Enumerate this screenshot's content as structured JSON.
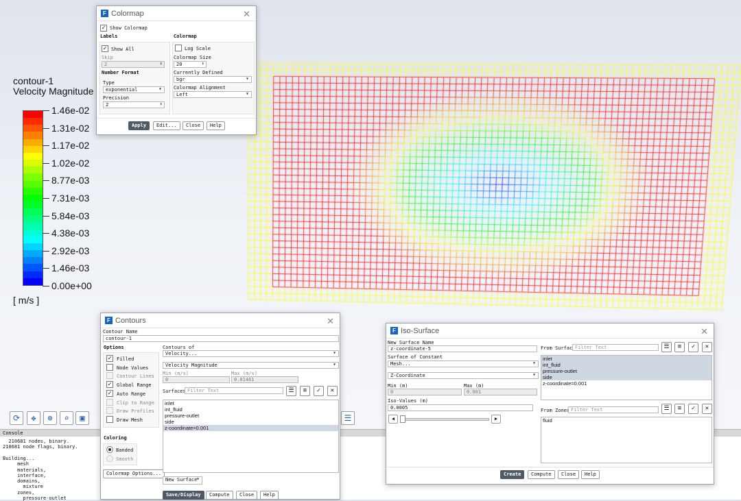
{
  "legend": {
    "title_line1": "contour-1",
    "title_line2": "Velocity Magnitude",
    "labels": [
      "1.46e-02",
      "1.31e-02",
      "1.17e-02",
      "1.02e-02",
      "8.77e-03",
      "7.31e-03",
      "5.84e-03",
      "4.38e-03",
      "2.92e-03",
      "1.46e-03",
      "0.00e+00"
    ],
    "unit": "[ m/s ]",
    "colors": [
      "#ff0000",
      "#ff2a00",
      "#ff5500",
      "#ff8000",
      "#ffaa00",
      "#ffd500",
      "#ffff00",
      "#d5ff00",
      "#aaff00",
      "#80ff00",
      "#55ff00",
      "#2aff00",
      "#00ff00",
      "#00ff2a",
      "#00ff55",
      "#00ff80",
      "#00ffaa",
      "#00ffd5",
      "#00ffff",
      "#00d5ff",
      "#00aaff",
      "#0080ff",
      "#0055ff",
      "#002aff",
      "#0000ff"
    ]
  },
  "colormap": {
    "title": "Colormap",
    "show_colormap": "Show Colormap",
    "labels_head": "Labels",
    "show_all": "Show All",
    "skip_label": "Skip",
    "skip_value": "2",
    "number_format": "Number Format",
    "type_label": "Type",
    "type_value": "exponential",
    "precision_label": "Precision",
    "precision_value": "2",
    "colormap_head": "Colormap",
    "log_scale": "Log Scale",
    "size_label": "Colormap Size",
    "size_value": "20",
    "defined_label": "Currently Defined",
    "defined_value": "bgr",
    "align_label": "Colormap Alignment",
    "align_value": "Left",
    "apply": "Apply",
    "edit": "Edit...",
    "close": "Close",
    "help": "Help"
  },
  "contours": {
    "title": "Contours",
    "name_label": "Contour Name",
    "name_value": "contour-1",
    "options_head": "Options",
    "options": [
      {
        "label": "Filled",
        "checked": true,
        "disabled": false
      },
      {
        "label": "Node Values",
        "checked": false,
        "disabled": false
      },
      {
        "label": "Contour Lines",
        "checked": false,
        "disabled": true
      },
      {
        "label": "Global Range",
        "checked": true,
        "disabled": false
      },
      {
        "label": "Auto Range",
        "checked": true,
        "disabled": false
      },
      {
        "label": "Clip to Range",
        "checked": false,
        "disabled": true
      },
      {
        "label": "Draw Profiles",
        "checked": false,
        "disabled": true
      },
      {
        "label": "Draw Mesh",
        "checked": false,
        "disabled": false
      }
    ],
    "coloring_head": "Coloring",
    "banded": "Banded",
    "smooth": "Smooth",
    "colormap_options": "Colormap Options...",
    "contours_of": "Contours of",
    "contours_of_value": "Velocity...",
    "quantity_value": "Velocity Magnitude",
    "min_label": "Min (m/s)",
    "min_value": "0",
    "max_label": "Max (m/s)",
    "max_value": "0.01461",
    "surfaces_label": "Surfaces",
    "surfaces_filter": "Filter Text",
    "surfaces": [
      "inlet",
      "int_fluid",
      "pressure-outlet",
      "side",
      "z-coordinate=0.001"
    ],
    "new_surface": "New Surface",
    "save_display": "Save/Display",
    "compute": "Compute",
    "close": "Close",
    "help": "Help"
  },
  "iso": {
    "title": "Iso-Surface",
    "new_name_label": "New Surface Name",
    "new_name_value": "z-coordinate-5",
    "constant_label": "Surface of Constant",
    "constant_value": "Mesh...",
    "coord_value": "Z-Coordinate",
    "min_label": "Min (m)",
    "min_value": "0",
    "max_label": "Max (m)",
    "max_value": "0.001",
    "iso_values_label": "Iso-Values (m)",
    "iso_values_value": "0.0005",
    "from_surface_label": "From Surface",
    "from_surface_filter": "Filter Text",
    "from_surface": [
      "inlet",
      "int_fluid",
      "pressure-outlet",
      "side",
      "z-coordinate=0.001"
    ],
    "from_zones_label": "From Zones",
    "from_zones_filter": "Filter Text",
    "zones": [
      "fluid"
    ],
    "create": "Create",
    "compute": "Compute",
    "close": "Close",
    "help": "Help"
  },
  "console": {
    "title": "Console",
    "lines": [
      "  210681 nodes, binary.",
      "210681 node flags, binary.",
      "",
      "Building...",
      "     mesh",
      "     materials,",
      "     interface,",
      "     domains,",
      "       mixture",
      "     zones,",
      "       pressure-outlet"
    ]
  }
}
